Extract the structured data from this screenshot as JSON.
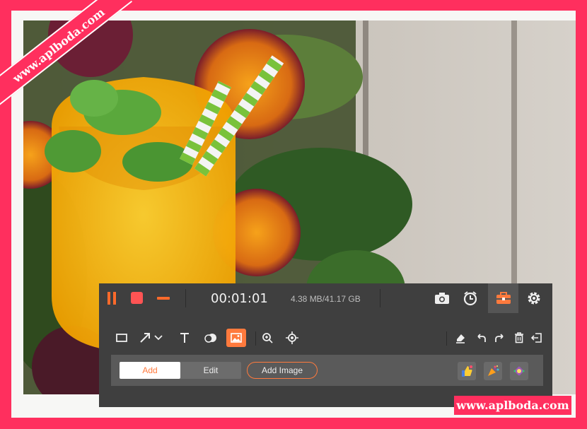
{
  "watermark": {
    "ribbon_text": "www.aplboda.com",
    "badge_text": "www.aplboda.com"
  },
  "recorder": {
    "timer": "00:01:01",
    "file_size": "4.38 MB/41.17 GB",
    "icons": [
      "pause-icon",
      "stop-icon",
      "minimize-icon",
      "camera-icon",
      "schedule-clock-icon",
      "toolbox-icon",
      "gear-icon"
    ]
  },
  "tools": {
    "icons": [
      "rectangle-icon",
      "arrow-icon",
      "text-icon",
      "callout-icon",
      "image-icon",
      "zoom-in-icon",
      "spotlight-icon",
      "eraser-icon",
      "undo-icon",
      "redo-icon",
      "trash-icon",
      "exit-icon"
    ],
    "active_tool": "image-icon"
  },
  "image_panel": {
    "add_label": "Add",
    "edit_label": "Edit",
    "add_image_label": "Add Image",
    "stickers": [
      "thumbs-up-sticker",
      "party-popper-sticker",
      "candy-sticker"
    ]
  },
  "colors": {
    "accent": "#ff7a3d",
    "frame": "#ff2f5e",
    "toolbar_bg": "#3f3f3f"
  }
}
